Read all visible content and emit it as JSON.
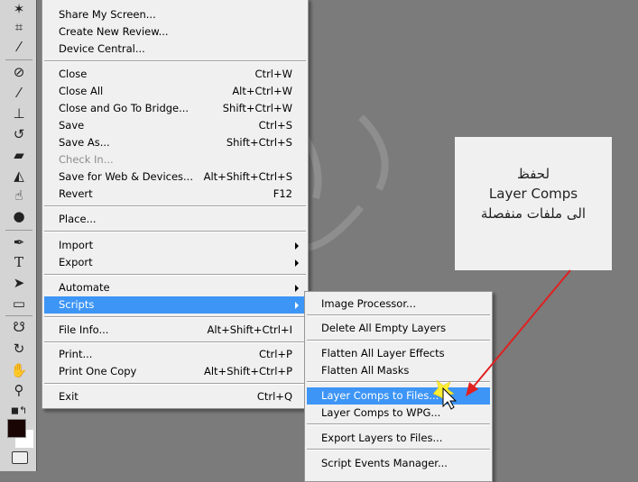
{
  "toolbar": {
    "tools": [
      "magic-wand",
      "crop",
      "eyedropper",
      "spot-healing",
      "brush",
      "clone-stamp",
      "history-brush",
      "eraser",
      "paint-bucket",
      "blur",
      "dodge",
      "pen",
      "type",
      "path-select",
      "rectangle",
      "3d-rotate",
      "3d-orbit",
      "hand",
      "zoom"
    ],
    "foreground_color": "#1a0505",
    "background_color": "#ffffff"
  },
  "menu": {
    "items": [
      {
        "label": "Share My Screen..."
      },
      {
        "label": "Create New Review..."
      },
      {
        "label": "Device Central..."
      },
      {
        "label": "Close",
        "shortcut": "Ctrl+W"
      },
      {
        "label": "Close All",
        "shortcut": "Alt+Ctrl+W"
      },
      {
        "label": "Close and Go To Bridge...",
        "shortcut": "Shift+Ctrl+W"
      },
      {
        "label": "Save",
        "shortcut": "Ctrl+S"
      },
      {
        "label": "Save As...",
        "shortcut": "Shift+Ctrl+S"
      },
      {
        "label": "Check In...",
        "disabled": true
      },
      {
        "label": "Save for Web & Devices...",
        "shortcut": "Alt+Shift+Ctrl+S"
      },
      {
        "label": "Revert",
        "shortcut": "F12"
      },
      {
        "label": "Place..."
      },
      {
        "label": "Import"
      },
      {
        "label": "Export"
      },
      {
        "label": "Automate"
      },
      {
        "label": "Scripts",
        "highlighted": true
      },
      {
        "label": "File Info...",
        "shortcut": "Alt+Shift+Ctrl+I"
      },
      {
        "label": "Print...",
        "shortcut": "Ctrl+P"
      },
      {
        "label": "Print One Copy",
        "shortcut": "Alt+Shift+Ctrl+P"
      },
      {
        "label": "Exit",
        "shortcut": "Ctrl+Q"
      }
    ]
  },
  "submenu": {
    "items": [
      {
        "label": "Image Processor..."
      },
      {
        "label": "Delete All Empty Layers"
      },
      {
        "label": "Flatten All Layer Effects"
      },
      {
        "label": "Flatten All Masks"
      },
      {
        "label": "Layer Comps to Files...",
        "highlighted": true
      },
      {
        "label": "Layer Comps to WPG..."
      },
      {
        "label": "Export Layers to Files..."
      },
      {
        "label": "Script Events Manager..."
      }
    ]
  },
  "callout": {
    "line1": "لحفظ",
    "line2": "Layer Comps",
    "line3": "الى ملفات منفصلة"
  },
  "colors": {
    "highlight": "#3d95f6",
    "arrow": "#e02020",
    "canvas": "#7b7b7b"
  }
}
